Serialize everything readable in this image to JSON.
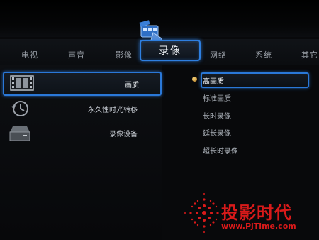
{
  "tabs": [
    {
      "label": "电视"
    },
    {
      "label": "声音"
    },
    {
      "label": "影像"
    },
    {
      "label": "录像",
      "active": true
    },
    {
      "label": "网络"
    },
    {
      "label": "系统"
    },
    {
      "label": "其它"
    }
  ],
  "active_tab_icon": "film-camera-icon",
  "menu": [
    {
      "label": "画质",
      "icon": "film-strip-icon",
      "selected": true
    },
    {
      "label": "永久性时光转移",
      "icon": "clock-rewind-icon"
    },
    {
      "label": "录像设备",
      "icon": "hard-drive-icon"
    }
  ],
  "options": [
    {
      "label": "高画质",
      "selected": true
    },
    {
      "label": "标准画质"
    },
    {
      "label": "长时录像"
    },
    {
      "label": "延长录像"
    },
    {
      "label": "超长时录像"
    }
  ],
  "watermark": {
    "text": "投影时代",
    "url": "www.PjTime.com"
  },
  "colors": {
    "accent": "#2a78d8",
    "background": "#08090b",
    "watermark": "#d81a1a"
  }
}
